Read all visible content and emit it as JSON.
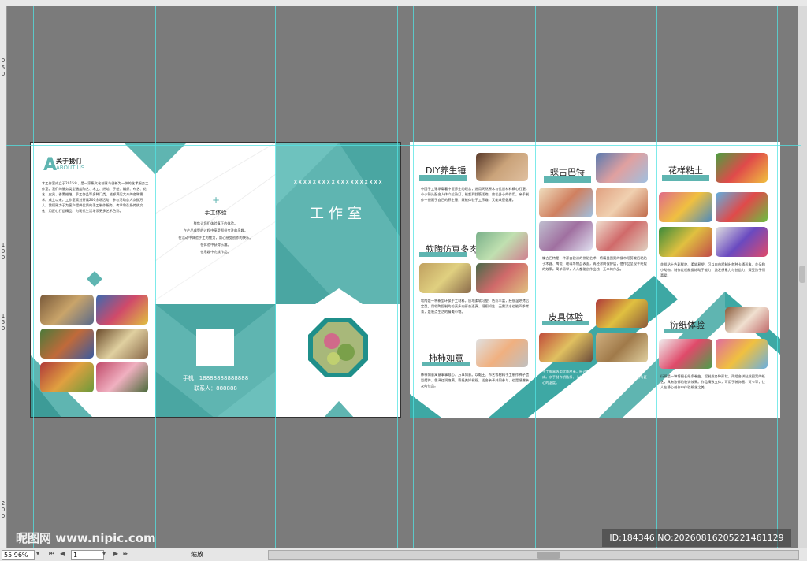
{
  "ruler_left_marks": [
    "0",
    "5",
    "0",
    "1",
    "0",
    "0",
    "1",
    "5",
    "0",
    "2",
    "0",
    "0"
  ],
  "brochure_left": {
    "about_title": "关于我们",
    "about_sub": "ABOUT US",
    "about_text": "本工作室成立于2015年，是一家集文化创意与创新为一体的艺术服务工作室。我们的服务类型涵盖陶艺、木工、烘焙、手绘、编织、布艺、花艺、皮具、香薰蜡烛、手工饰品等多种门类，能够满足大众的各种需求。成立以来，工作室策划开展200余场活动，参与活动总人次数万人。我们致力于为客户提供优质的手工制作服务，传承和弘扬传统文化，用匠心打造精品，为现代生活增添更多艺术色彩。",
    "center_panel": {
      "heading": "手工体验",
      "lines": [
        "聚焦让您们体验真正的体验。",
        "在产品成型的过程中享受那份专注的乐趣。",
        "在活动中体验手工的魅力，用心感受创作的快乐。",
        "在体验中获得乐趣。",
        "在乐趣中完成作品。"
      ],
      "phone": "手机：18888888888888",
      "contact": "联系人：888888"
    },
    "cover": {
      "x_line": "XXXXXXXXXXXXXXXXXXX",
      "title": "工作室"
    }
  },
  "brochure_right": {
    "sections": [
      {
        "title": "DIY养生锤",
        "text": "中国手工锤承载着中医养生的理念，选用天然原木与优质材料精心打磨，小小锤头配合人体穴位敲打，能起到舒筋活络、放松身心的作用。亲手制作一把属于自己的养生锤，既能体验手工乐趣，又能收获健康。"
      },
      {
        "title": "软陶仿真多肉",
        "text": "软陶是一种新型环保手工材料，质地柔软可塑，色彩丰富，经低温烘烤后定型。用软陶捏制的仿真多肉形态逼真、栩栩如生，无需浇水也能四季常青，是装点生活的精美小物。"
      },
      {
        "title": "柿柿如意",
        "text": "柿柿如意寓意事事顺心、万事如意。以黏土、布艺等材料手工制作柿子造型摆件，色泽红润饱满，寄托美好祝福，适合亲子共同参与，也是馈赠亲友的佳品。"
      },
      {
        "title": "蝶古巴特",
        "text": "蝶古巴特是一种源自欧洲的拼贴艺术，将精美图案的餐巾纸剪裁后粘贴于木器、陶瓷、玻璃等物品表面，再经涂刷保护层，使作品呈现手绘般的效果。简单易学，人人都能创作出独一无二的作品。"
      },
      {
        "title": "皮具体验",
        "text": "手工皮具选用优质皮革，经过裁剪、打孔、缝线、封边等工序制作而成。亲手制作钥匙扣、卡包、钱包等小物件，感受皮革温润的质感与匠心的温度。"
      },
      {
        "title": "花样粘土",
        "text": "花样粘土色彩鲜艳、柔软易塑，可以自由捏制出各种卡通形象、花朵和小动物。制作过程能锻炼动手能力，激发想象力与创造力，深受孩子们喜爱。"
      },
      {
        "title": "衍纸体验",
        "text": "衍纸是一种将细长纸条卷曲、捏制成各种形状，再组合拼贴成图案的纸艺，具有浓郁的装饰效果。作品精致立体，可用于装饰画、贺卡等，让人在静心创作中体验纸艺之美。"
      }
    ]
  },
  "status": {
    "zoom": "55.96%",
    "page": "1",
    "label": "缩放"
  },
  "watermark": {
    "left": "昵图网 www.nipic.com",
    "id": "ID:184346 NO:20260816205221461129"
  }
}
